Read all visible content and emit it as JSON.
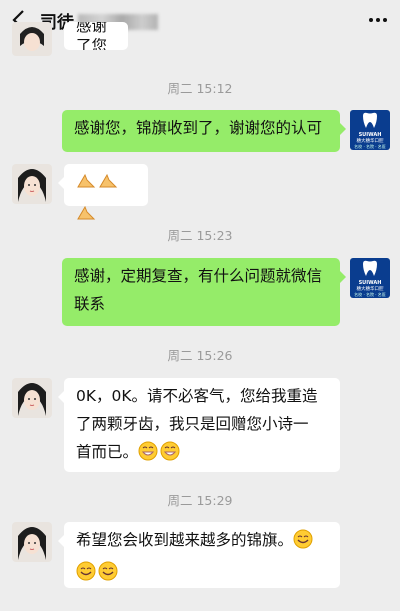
{
  "header": {
    "title": "司徒",
    "back_icon": "chevron-left-icon",
    "more_icon": "more-dots-icon"
  },
  "messages": [
    {
      "side": "left",
      "partial_text": "感谢了您"
    },
    {
      "type": "time",
      "text": "周二 15:12"
    },
    {
      "side": "right",
      "text": "感谢您，锦旗收到了，谢谢您的认可"
    },
    {
      "side": "left",
      "emoji": "pray-hands-icon",
      "count": 3
    },
    {
      "type": "time",
      "text": "周二 15:23"
    },
    {
      "side": "right",
      "lines": [
        "感谢，定期复查，有什么问题就微信",
        "联系"
      ]
    },
    {
      "type": "time",
      "text": "周二 15:26"
    },
    {
      "side": "left",
      "lines": [
        "0K，0K。请不必客气，您给我重造",
        "了两颗牙齿，我只是回赠您小诗一",
        "首而已。"
      ],
      "trail_emoji": "grin-icon",
      "trail_count": 2
    },
    {
      "type": "time",
      "text": "周二 15:29"
    },
    {
      "side": "left",
      "lines": [
        "希望您会收到越来越多的锦旗。"
      ],
      "trail_emoji": "smile-icon",
      "second_line_emoji_count": 2
    }
  ],
  "logo": {
    "brand": "SUIWAH",
    "name": "穗大穗华口腔",
    "tagline": "名校 · 名院 · 名医"
  },
  "colors": {
    "bg": "#ededed",
    "green_bubble": "#95ec69",
    "white_bubble": "#ffffff",
    "logo_blue": "#0a3d8f"
  }
}
